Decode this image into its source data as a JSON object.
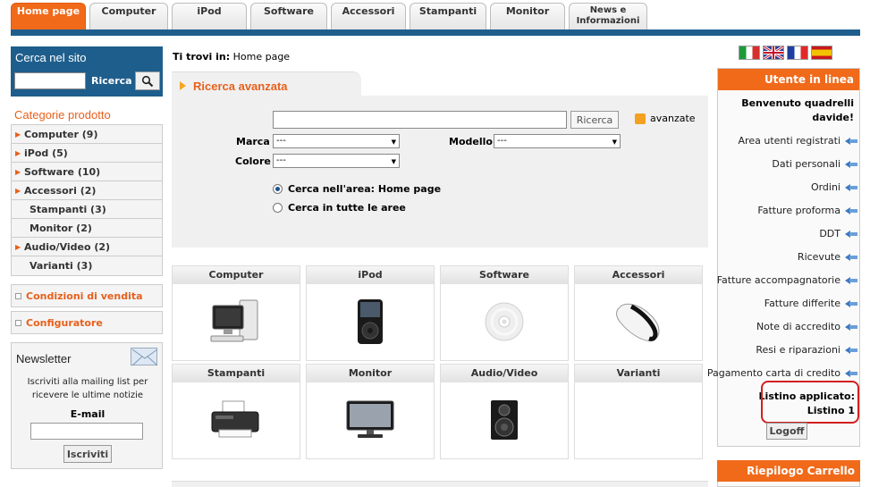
{
  "nav": {
    "tabs": [
      "Home page",
      "Computer",
      "iPod",
      "Software",
      "Accessori",
      "Stampanti",
      "Monitor",
      "News e\nInformazioni"
    ],
    "active_index": 0,
    "accent_color": "#f06a1a",
    "bar_color": "#1e5e8c"
  },
  "site_search": {
    "title": "Cerca nel sito",
    "button_label": "Ricerca",
    "icon": "magnifier-icon"
  },
  "categories": {
    "title": "Categorie prodotto",
    "items": [
      {
        "label": "Computer (9)",
        "arrow": true
      },
      {
        "label": "iPod (5)",
        "arrow": true
      },
      {
        "label": "Software (10)",
        "arrow": true
      },
      {
        "label": "Accessori (2)",
        "arrow": true
      },
      {
        "label": "Stampanti (3)",
        "arrow": false
      },
      {
        "label": "Monitor (2)",
        "arrow": false
      },
      {
        "label": "Audio/Video (2)",
        "arrow": true
      },
      {
        "label": "Varianti (3)",
        "arrow": false
      }
    ]
  },
  "links": {
    "conditions": "Condizioni di vendita",
    "configurator": "Configuratore"
  },
  "newsletter": {
    "title": "Newsletter",
    "description": "Iscriviti alla mailing list per ricevere le ultime notizie",
    "email_label": "E-mail",
    "button_label": "Iscriviti"
  },
  "breadcrumb": {
    "prefix": "Ti trovi in:",
    "current": "Home page"
  },
  "advanced_search": {
    "title": "Ricerca avanzata",
    "button_label": "Ricerca",
    "advanced_label": "avanzate",
    "brand_label": "Marca",
    "brand_value": "---",
    "model_label": "Modello",
    "model_value": "---",
    "color_label": "Colore",
    "color_value": "---",
    "radio_area": "Cerca nell'area: Home page",
    "radio_all": "Cerca in tutte le aree",
    "selected_radio": "area"
  },
  "products": [
    {
      "title": "Computer",
      "icon": "computer-icon"
    },
    {
      "title": "iPod",
      "icon": "ipod-icon"
    },
    {
      "title": "Software",
      "icon": "cd-icon"
    },
    {
      "title": "Accessori",
      "icon": "mouse-icon"
    },
    {
      "title": "Stampanti",
      "icon": "printer-icon"
    },
    {
      "title": "Monitor",
      "icon": "monitor-icon"
    },
    {
      "title": "Audio/Video",
      "icon": "speaker-icon"
    },
    {
      "title": "Varianti",
      "icon": ""
    }
  ],
  "languages": [
    "italian-flag-icon",
    "english-flag-icon",
    "french-flag-icon",
    "spanish-flag-icon"
  ],
  "user_panel": {
    "title": "Utente in linea",
    "welcome": "Benvenuto quadrelli davide!",
    "links": [
      "Area utenti registrati",
      "Dati personali",
      "Ordini",
      "Fatture proforma",
      "DDT",
      "Ricevute",
      "Fatture accompagnatorie",
      "Fatture differite",
      "Note di accredito",
      "Resi e riparazioni",
      "Pagamento carta di credito"
    ],
    "price_list_label": "Listino applicato:",
    "price_list_value": "Listino 1",
    "logoff_label": "Logoff",
    "highlight_color": "#d21f1f"
  },
  "cart": {
    "title": "Riepilogo Carrello"
  }
}
